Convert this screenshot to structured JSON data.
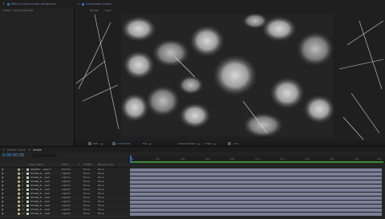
{
  "project_panel": {
    "tab_label": "Effect Controls Smoke_background",
    "breadcrumb": "smoke • Smoke_Tank.psd"
  },
  "composition_panel": {
    "tab_label": "Composition Smoke",
    "sub_tabs": [
      "Render",
      "Layer"
    ],
    "footer": {
      "zoom": "50%",
      "timecode": "0:00:00:00",
      "resolution": "Full",
      "camera": "Active Camera",
      "views": "1 View",
      "exposure": "+0.0"
    }
  },
  "timeline_panel": {
    "tabs": [
      "Render Queue",
      "Smoke"
    ],
    "current_time": "0:00:00:00",
    "columns": [
      "Layer Name",
      "Mode",
      "T",
      "TrkMat",
      "Parent & Link"
    ],
    "ruler_labels": [
      "0s",
      "02s",
      "04s",
      "06s",
      "08s",
      "10s",
      "12s",
      "14s",
      "16s",
      "18s",
      "20s"
    ],
    "layers": [
      {
        "num": "1",
        "name": "Adjustm... ayer 1",
        "mode": "Normal",
        "trkmat": "None",
        "parent": "None"
      },
      {
        "num": "2",
        "name": "Smoke_S... .psd",
        "mode": "Lighten",
        "trkmat": "None",
        "parent": "None"
      },
      {
        "num": "3",
        "name": "Smoke_S... .psd",
        "mode": "Lighten",
        "trkmat": "None",
        "parent": "None"
      },
      {
        "num": "4",
        "name": "Smoke_S... .psd",
        "mode": "Lighten",
        "trkmat": "None",
        "parent": "None"
      },
      {
        "num": "5",
        "name": "Smoke_S... .psd",
        "mode": "Lighten",
        "trkmat": "None",
        "parent": "None"
      },
      {
        "num": "6",
        "name": "Smoke_S... .psd",
        "mode": "Lighten",
        "trkmat": "None",
        "parent": "None"
      },
      {
        "num": "7",
        "name": "Smoke_S... .psd",
        "mode": "Lighten",
        "trkmat": "None",
        "parent": "None"
      },
      {
        "num": "8",
        "name": "Smoke_S... .psd",
        "mode": "Lighten",
        "trkmat": "None",
        "parent": "None"
      },
      {
        "num": "9",
        "name": "Smoke_S... .psd",
        "mode": "Lighten",
        "trkmat": "None",
        "parent": "None"
      },
      {
        "num": "10",
        "name": "Smoke_S... .psd",
        "mode": "Lighten",
        "trkmat": "None",
        "parent": "None"
      },
      {
        "num": "11",
        "name": "Smoke_S... .psd",
        "mode": "Lighten",
        "trkmat": "None",
        "parent": "None"
      },
      {
        "num": "12",
        "name": "Smoke_S... .psd",
        "mode": "Lighten",
        "trkmat": "None",
        "parent": "None"
      }
    ]
  },
  "colors": {
    "accent": "#2e6dbf",
    "timecode": "#4a9ad8",
    "track_bar": "#7b7f96",
    "work_area": "#3d8a3a"
  }
}
